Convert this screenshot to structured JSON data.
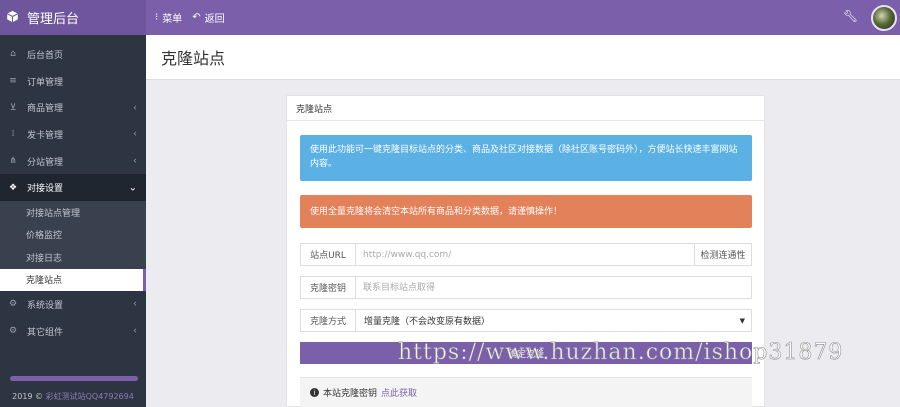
{
  "header": {
    "brand_icon": "cube-icon",
    "title": "管理后台",
    "nav": [
      {
        "icon": "dots-vertical-icon",
        "label": "菜单"
      },
      {
        "icon": "undo-icon",
        "label": "返回"
      }
    ],
    "right_icon": "wrench-icon",
    "accent": "#7b5fab"
  },
  "sidebar": {
    "items": [
      {
        "icon": "home-icon",
        "label": "后台首页"
      },
      {
        "icon": "list-icon",
        "label": "订单管理"
      },
      {
        "icon": "cart-icon",
        "label": "商品管理"
      },
      {
        "icon": "grid-icon",
        "label": "发卡管理"
      },
      {
        "icon": "sitemap-icon",
        "label": "分站管理"
      },
      {
        "icon": "cubes-icon",
        "label": "对接设置"
      }
    ],
    "submenu": [
      "对接站点管理",
      "价格监控",
      "对接日志",
      "克隆站点"
    ],
    "items_after": [
      {
        "icon": "gear-icon",
        "label": "系统设置"
      },
      {
        "icon": "gears-icon",
        "label": "其它组件"
      }
    ],
    "footer_year": "2019 ©",
    "footer_text": "彩虹测试站QQ4792694"
  },
  "page": {
    "title": "克隆站点",
    "panel_title": "克隆站点",
    "info_alert": "使用此功能可一键克隆目标站点的分类、商品及社区对接数据（除社区账号密码外），方便站长快速丰富网站内容。",
    "warn_alert": "使用全量克隆将会清空本站所有商品和分类数据，请谨慎操作！",
    "url_label": "站点URL",
    "url_placeholder": "http://www.qq.com/",
    "check_button": "检测连通性",
    "key_label": "克隆密钥",
    "key_placeholder": "联系目标站点取得",
    "mode_label": "克隆方式",
    "mode_value": "增量克隆（不会改变原有数据）",
    "submit_label": "确定克隆",
    "notice_text": "本站克隆密钥",
    "notice_link": "点此获取"
  },
  "watermark": "https://www.huzhan.com/ishop31879"
}
